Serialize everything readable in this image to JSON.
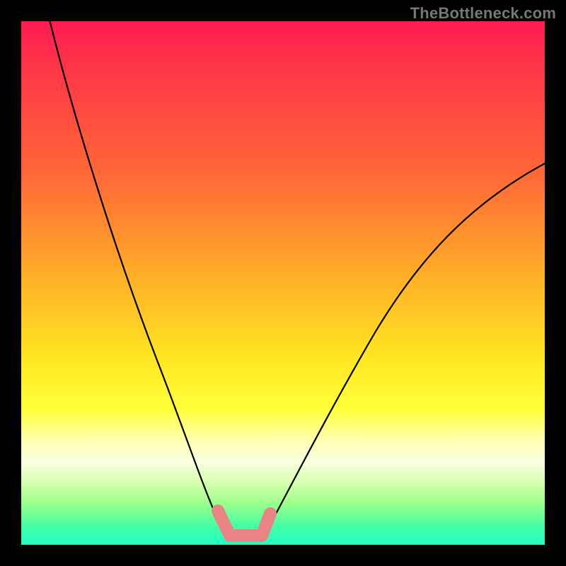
{
  "watermark": "TheBottleneck.com",
  "colors": {
    "background": "#000000",
    "gradient_top": "#ff1a52",
    "gradient_mid": "#ffe822",
    "gradient_bottom": "#1fffc8",
    "curve": "#000000",
    "marker": "#e88484"
  },
  "chart_data": {
    "type": "line",
    "title": "",
    "xlabel": "",
    "ylabel": "",
    "xlim": [
      0,
      100
    ],
    "ylim": [
      0,
      100
    ],
    "series": [
      {
        "name": "bottleneck-curve",
        "x": [
          5,
          10,
          15,
          20,
          25,
          30,
          33,
          36,
          38,
          40,
          45,
          50,
          55,
          60,
          65,
          70,
          75,
          80,
          85,
          90,
          95,
          100
        ],
        "y": [
          100,
          83,
          67,
          51,
          36,
          22,
          12,
          6,
          2,
          0,
          0,
          3,
          9,
          16,
          24,
          32,
          40,
          47,
          54,
          60,
          65,
          70
        ]
      }
    ],
    "annotations": [
      {
        "name": "optimal-zone",
        "x": [
          36,
          45
        ],
        "y": [
          6,
          0
        ]
      }
    ]
  }
}
